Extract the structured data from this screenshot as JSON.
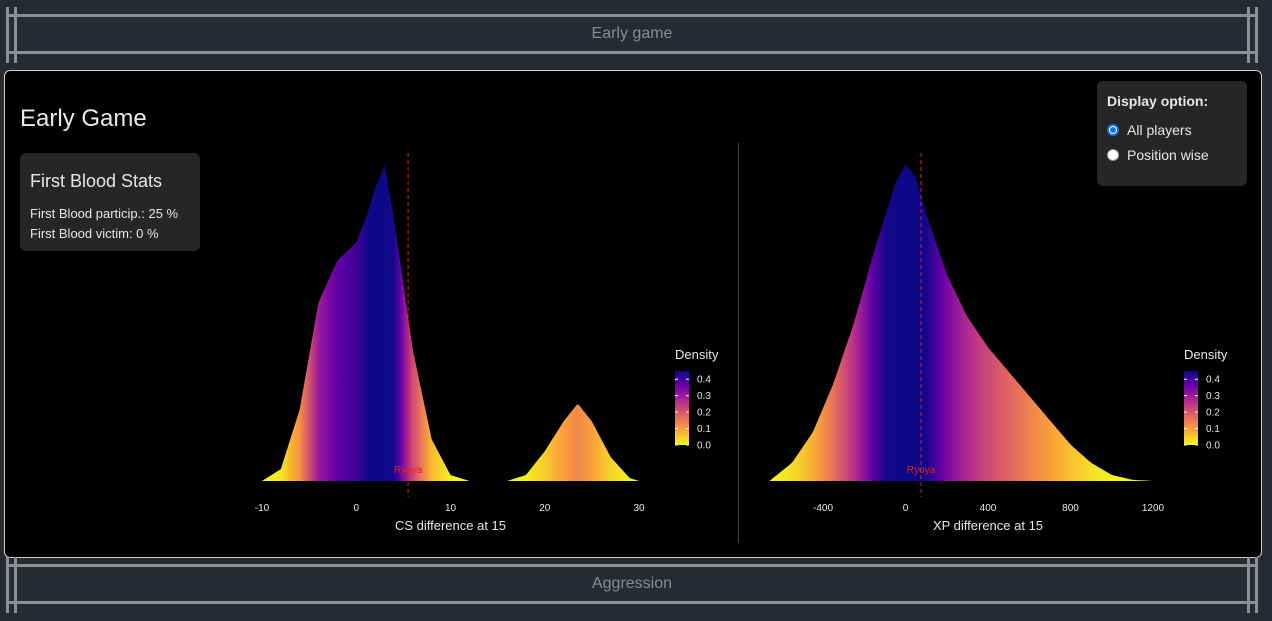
{
  "sections": {
    "top": "Early game",
    "bottom": "Aggression"
  },
  "panel": {
    "title": "Early Game",
    "first_blood": {
      "title": "First Blood Stats",
      "participation": "First Blood particip.: 25 %",
      "victim": "First Blood victim: 0 %"
    },
    "display_option": {
      "title": "Display option:",
      "options": [
        {
          "label": "All players",
          "checked": true
        },
        {
          "label": "Position wise",
          "checked": false
        }
      ]
    }
  },
  "colors": {
    "bg": "#272a30",
    "panel_bg": "#000000",
    "marker": "#e0201a",
    "plasma": [
      "#0d0887",
      "#6a00a8",
      "#b12a90",
      "#e16462",
      "#fca636",
      "#f0f921"
    ]
  },
  "chart_data": [
    {
      "type": "area",
      "title": "",
      "xlabel": "CS difference at 15",
      "ylabel": "",
      "xlim": [
        -10,
        30
      ],
      "xticks": [
        -10,
        0,
        10,
        20,
        30
      ],
      "x": [
        -10,
        -8,
        -6,
        -4,
        -2,
        0,
        1,
        2,
        3,
        4,
        5,
        6,
        8,
        10,
        12,
        14,
        16,
        18,
        20,
        22,
        23.5,
        25,
        27,
        29,
        30
      ],
      "density": [
        0.0,
        0.02,
        0.12,
        0.3,
        0.37,
        0.4,
        0.44,
        0.49,
        0.53,
        0.44,
        0.33,
        0.22,
        0.07,
        0.01,
        0.0,
        0.0,
        0.0,
        0.01,
        0.05,
        0.1,
        0.13,
        0.1,
        0.04,
        0.005,
        0.0
      ],
      "marker": {
        "x": 5.5,
        "label": "Ryoya"
      },
      "legend": {
        "title": "Density",
        "ticks": [
          "0.4",
          "0.3",
          "0.2",
          "0.1",
          "0.0"
        ],
        "max": 0.45
      }
    },
    {
      "type": "area",
      "title": "",
      "xlabel": "XP difference at 15",
      "ylabel": "",
      "xlim": [
        -400,
        1200
      ],
      "xticks": [
        -400,
        0,
        400,
        800,
        1200
      ],
      "x": [
        -660,
        -550,
        -450,
        -350,
        -250,
        -150,
        -50,
        0,
        50,
        100,
        200,
        300,
        400,
        500,
        600,
        700,
        800,
        900,
        1000,
        1100,
        1200
      ],
      "density": [
        0.0,
        0.03,
        0.08,
        0.16,
        0.26,
        0.38,
        0.49,
        0.52,
        0.5,
        0.44,
        0.34,
        0.27,
        0.22,
        0.18,
        0.14,
        0.1,
        0.06,
        0.03,
        0.01,
        0.002,
        0.0
      ],
      "marker": {
        "x": 75,
        "label": "Ryoya"
      },
      "legend": {
        "title": "Density",
        "ticks": [
          "0.4",
          "0.3",
          "0.2",
          "0.1",
          "0.0"
        ],
        "max": 0.45
      }
    }
  ]
}
